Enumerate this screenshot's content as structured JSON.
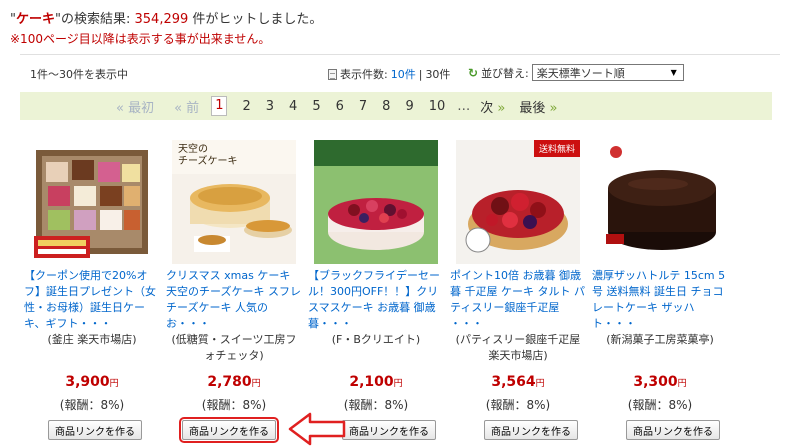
{
  "search": {
    "q_open": "\"",
    "keyword": "ケーキ",
    "q_close": "\"の検索結果: ",
    "count": "354,299",
    "suffix": " 件がヒットしました。",
    "notice": "※100ページ目以降は表示する事が出来ません。"
  },
  "toolbar": {
    "range": "1件～30件を表示中",
    "perpage_label": "表示件数: ",
    "perpage_10": "10件",
    "perpage_sep": " | ",
    "perpage_30": "30件",
    "sort_label": "並び替え:",
    "sort_value": "楽天標準ソート順"
  },
  "pager": {
    "first": "« 最初",
    "prev": "« 前",
    "current": "1",
    "pages": [
      "2",
      "3",
      "4",
      "5",
      "6",
      "7",
      "8",
      "9",
      "10"
    ],
    "dots": "…",
    "next": "次",
    "next_arrow": "»",
    "last": "最後",
    "last_arrow": "»"
  },
  "products": [
    {
      "title": "【クーポン使用で20%オフ】誕生日プレゼント（女性・お母様）誕生日ケーキ、ギフト・・・",
      "shop": "(釜庄 楽天市場店)",
      "price": "3,900",
      "yen": "円",
      "reward": "(報酬：8%)",
      "button": "商品リンクを作る"
    },
    {
      "title": "クリスマス xmas ケーキ 天空のチーズケーキ スフレ チーズケーキ 人気のお・・・",
      "shop": "(低糖質・スイーツ工房フォチェッタ)",
      "price": "2,780",
      "yen": "円",
      "reward": "(報酬：8%)",
      "button": "商品リンクを作る",
      "thumb_text": "天空の\nチーズケーキ"
    },
    {
      "title": "【ブラックフライデーセール！300円OFF！！】クリスマスケーキ お歳暮 御歳暮・・・",
      "shop": "(F・Bクリエイト)",
      "price": "2,100",
      "yen": "円",
      "reward": "(報酬：8%)",
      "button": "商品リンクを作る"
    },
    {
      "title": "ポイント10倍 お歳暮 御歳暮 千疋屋 ケーキ タルト パティスリー銀座千疋屋 ・・・",
      "shop": "(パティスリー銀座千疋屋 楽天市場店)",
      "price": "3,564",
      "yen": "円",
      "reward": "(報酬：8%)",
      "button": "商品リンクを作る",
      "thumb_text": "送料無料"
    },
    {
      "title": "濃厚ザッハトルテ 15cm 5号 送料無料 誕生日 チョコレートケーキ ザッハト・・・",
      "shop": "(新潟菓子工房菜菓亭)",
      "price": "3,300",
      "yen": "円",
      "reward": "(報酬：8%)",
      "button": "商品リンクを作る"
    }
  ],
  "colors": {
    "accent": "#bf0000",
    "link": "#0066cc",
    "pager_bg": "#ecf3d6",
    "highlight": "#e02020"
  }
}
